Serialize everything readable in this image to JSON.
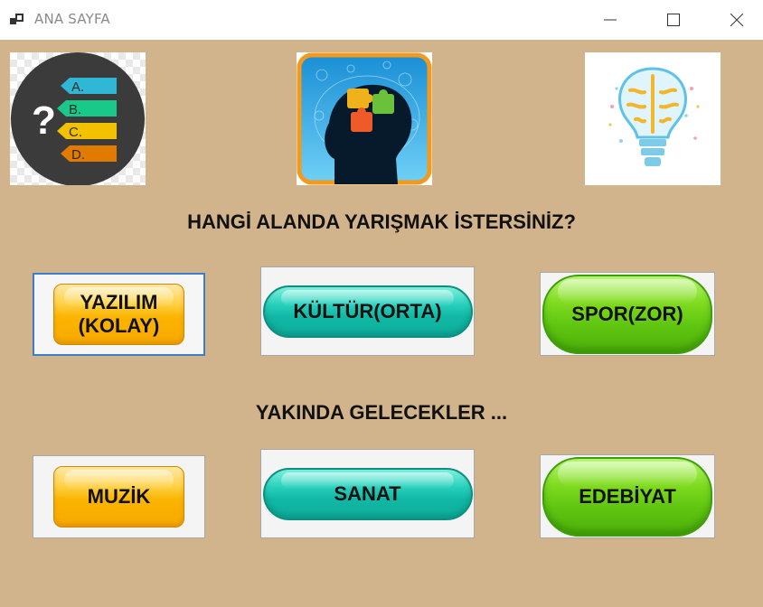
{
  "window": {
    "title": "ANA SAYFA",
    "controls": [
      "minimize",
      "maximize",
      "close"
    ]
  },
  "images": [
    {
      "name": "quiz-options-image",
      "options": [
        "A.",
        "B.",
        "C.",
        "D."
      ],
      "colors": [
        "#2fb7d6",
        "#19c98a",
        "#f2c200",
        "#e07b00"
      ]
    },
    {
      "name": "brain-puzzle-image"
    },
    {
      "name": "lightbulb-brain-image"
    }
  ],
  "question": "HANGİ ALANDA YARIŞMAK İSTERSİNİZ?",
  "categories": [
    {
      "label_line1": "YAZILIM",
      "label_line2": "(KOLAY)",
      "style": "orange",
      "focused": true
    },
    {
      "label": "KÜLTÜR(ORTA)",
      "style": "teal"
    },
    {
      "label": "SPOR(ZOR)",
      "style": "green"
    }
  ],
  "coming_soon_title": "YAKINDA GELECEKLER ...",
  "coming_soon": [
    {
      "label": "MUZİK",
      "style": "orange"
    },
    {
      "label": "SANAT",
      "style": "teal"
    },
    {
      "label": "EDEBİYAT",
      "style": "green"
    }
  ],
  "colors": {
    "background": "#d2b48c",
    "orange": "#f6a900",
    "teal": "#11b8a5",
    "green": "#5fc510",
    "focus": "#3a7fcf"
  }
}
